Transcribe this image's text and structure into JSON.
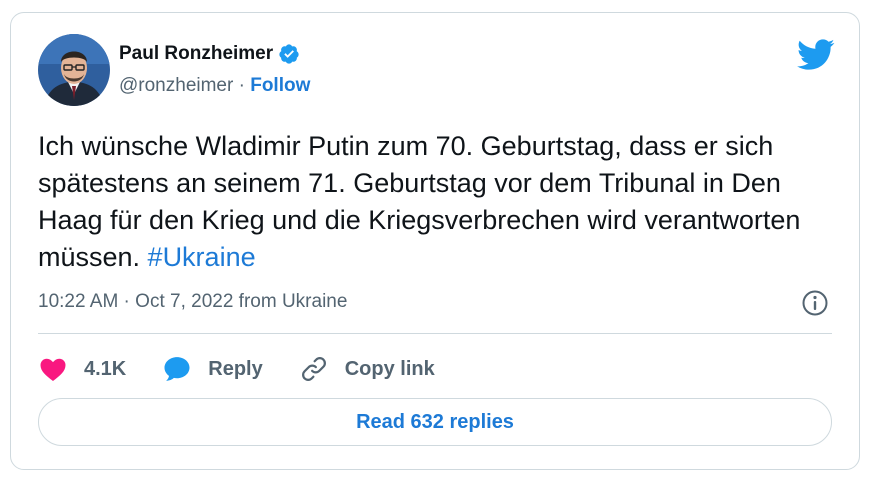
{
  "author": {
    "name": "Paul Ronzheimer",
    "handle": "@ronzheimer",
    "separator": " · ",
    "follow_label": "Follow"
  },
  "tweet": {
    "text": "Ich wünsche Wladimir Putin zum 70. Geburtstag, dass er sich spätestens an seinem 71. Geburtstag vor dem Tribunal in Den Haag für den Krieg und die Kriegsverbrechen wird verantworten müssen. ",
    "hashtag": "#Ukraine",
    "meta": "10:22 AM · Oct 7, 2022 from Ukraine"
  },
  "actions": {
    "like_count": "4.1K",
    "reply_label": "Reply",
    "copy_link_label": "Copy link"
  },
  "read_replies_label": "Read 632 replies",
  "colors": {
    "accent": "#1d7ad6",
    "like": "#f91880",
    "muted": "#536471",
    "border": "#cfd9de"
  },
  "icons": [
    "verified-badge-icon",
    "twitter-bird-icon",
    "info-icon",
    "heart-icon",
    "reply-bubble-icon",
    "link-icon"
  ]
}
